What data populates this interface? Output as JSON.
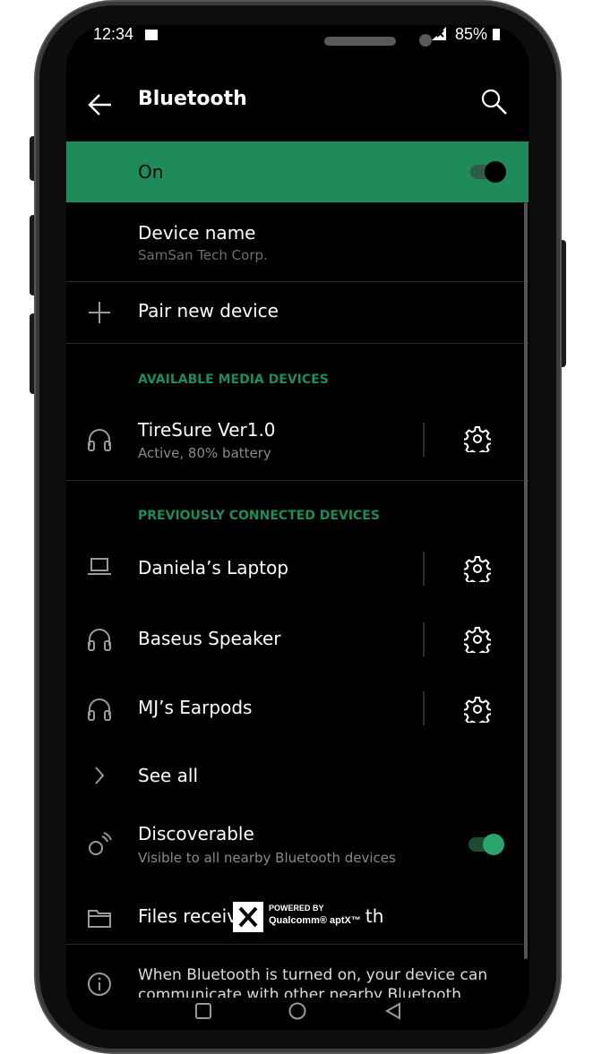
{
  "status_bar": {
    "time": "12:34",
    "battery": "85%"
  },
  "header": {
    "title": "Bluetooth"
  },
  "toggle_row": {
    "label": "On",
    "enabled": true
  },
  "device_name": {
    "label": "Device name",
    "value": "SamSan Tech Corp."
  },
  "pair": {
    "label": "Pair new device"
  },
  "available": {
    "header": "AVAILABLE MEDIA DEVICES",
    "devices": [
      {
        "name": "TireSure Ver1.0",
        "status": "Active, 80% battery",
        "icon": "headphones-icon"
      }
    ]
  },
  "previous": {
    "header": "PREVIOUSLY CONNECTED DEVICES",
    "devices": [
      {
        "name": "Daniela’s Laptop",
        "icon": "laptop-icon"
      },
      {
        "name": "Baseus Speaker",
        "icon": "headphones-icon"
      },
      {
        "name": "MJ’s Earpods",
        "icon": "headphones-icon"
      }
    ]
  },
  "see_all": {
    "label": "See all"
  },
  "discoverable": {
    "label": "Discoverable",
    "sub": "Visible to all nearby Bluetooth devices",
    "enabled": true
  },
  "files": {
    "label": "Files received via bluetooth"
  },
  "badge": {
    "line1": "POWERED BY",
    "line2": "Qualcomm® aptX™"
  },
  "info": {
    "text": "When Bluetooth is turned on, your device can communicate with other nearby Bluetooth devices"
  },
  "colors": {
    "accent": "#1f8a5a",
    "background": "#000000"
  }
}
